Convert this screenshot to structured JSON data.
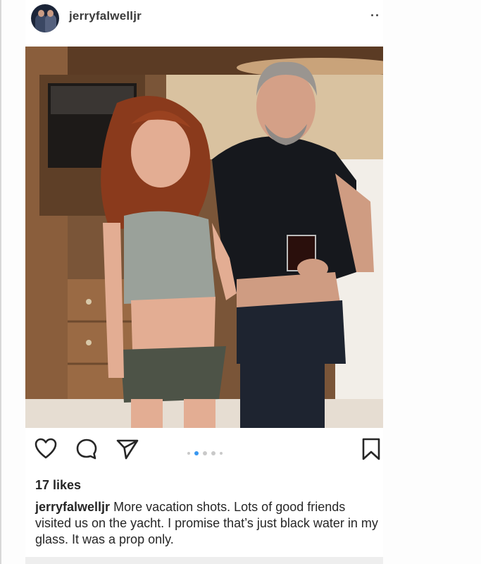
{
  "header": {
    "username": "jerryfalwelljr",
    "avatar_icon": "profile-avatar",
    "more_label": "··",
    "more_icon": "more-options-icon"
  },
  "photo": {
    "subject": "photo"
  },
  "actions": {
    "like_icon": "heart-icon",
    "comment_icon": "comment-icon",
    "share_icon": "send-icon",
    "save_icon": "bookmark-icon",
    "carousel_count": 5,
    "carousel_active_index": 1,
    "accent_color": "#3897f0"
  },
  "post": {
    "likes_text": "17 likes",
    "caption_username": "jerryfalwelljr",
    "caption_text": "More vacation shots.  Lots of good friends visited us on the yacht.  I promise that’s just black water in my glass.  It was a prop only."
  }
}
